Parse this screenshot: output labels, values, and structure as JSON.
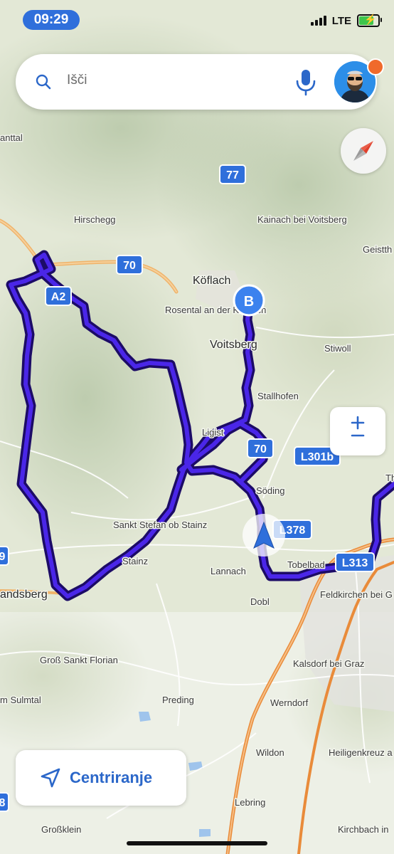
{
  "status_bar": {
    "time": "09:29",
    "network": "LTE",
    "signal_icon": "cellular-signal-icon",
    "battery_icon": "battery-charging-icon"
  },
  "search": {
    "placeholder": "Išči",
    "icon": "search-icon",
    "mic_icon": "microphone-icon",
    "avatar_icon": "profile-avatar-icon"
  },
  "map": {
    "places": [
      "anttal",
      "Hirschegg",
      "Kainach bei Voitsberg",
      "Geistth",
      "Köflach",
      "Rosental an der Kainach",
      "Voitsberg",
      "Stiwoll",
      "Stallhofen",
      "Ligist",
      "Söding",
      "Sankt Stefan ob Stainz",
      "Stainz",
      "Lannach",
      "Tobelbad",
      "Feldkirchen bei G",
      "andsberg",
      "Dobl",
      "Groß Sankt Florian",
      "Kalsdorf bei Graz",
      "m Sulmtal",
      "Preding",
      "Werndorf",
      "Wildon",
      "Heiligenkreuz a",
      "Lebring",
      "Großklein",
      "Kirchbach in",
      "Th"
    ],
    "road_shields": [
      "77",
      "70",
      "A2",
      "70",
      "L301b",
      "L378",
      "L313",
      "9",
      "8"
    ],
    "destination_marker": "B",
    "colors": {
      "route": "#3a17c9",
      "route_outline": "#1c0b66",
      "highway": "#e98b3a",
      "water": "#9fc4ec",
      "accent": "#2f6fdb"
    }
  },
  "controls": {
    "compass_icon": "compass-icon",
    "zoom_icon": "zoom-plus-minus-icon",
    "center_label": "Centriranje",
    "center_icon": "location-arrow-icon"
  }
}
